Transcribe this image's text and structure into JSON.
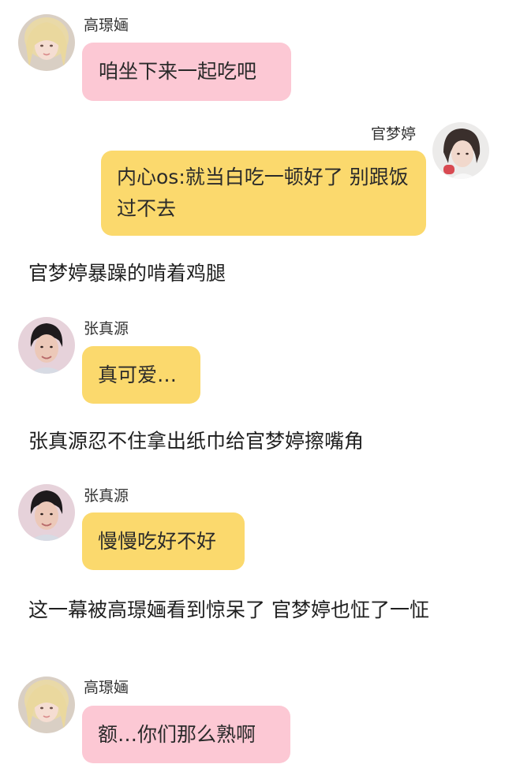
{
  "colors": {
    "pink_bubble": "#fcc8d4",
    "yellow_bubble": "#fbd96d",
    "background": "#ffffff"
  },
  "messages": [
    {
      "speaker": "高璟婳",
      "text": "咱坐下来一起吃吧",
      "bubble_color": "pink",
      "side": "left"
    },
    {
      "speaker": "官梦婷",
      "text": "内心os:就当白吃一顿好了 别跟饭过不去",
      "bubble_color": "yellow",
      "side": "right"
    },
    {
      "narration": "官梦婷暴躁的啃着鸡腿"
    },
    {
      "speaker": "张真源",
      "text": "真可爱…",
      "bubble_color": "yellow",
      "side": "left"
    },
    {
      "narration": "张真源忍不住拿出纸巾给官梦婷擦嘴角"
    },
    {
      "speaker": "张真源",
      "text": "慢慢吃好不好",
      "bubble_color": "yellow",
      "side": "left"
    },
    {
      "narration": "这一幕被高璟婳看到惊呆了 官梦婷也怔了一怔"
    },
    {
      "speaker": "高璟婳",
      "text": "额…你们那么熟啊",
      "bubble_color": "pink",
      "side": "left"
    }
  ]
}
